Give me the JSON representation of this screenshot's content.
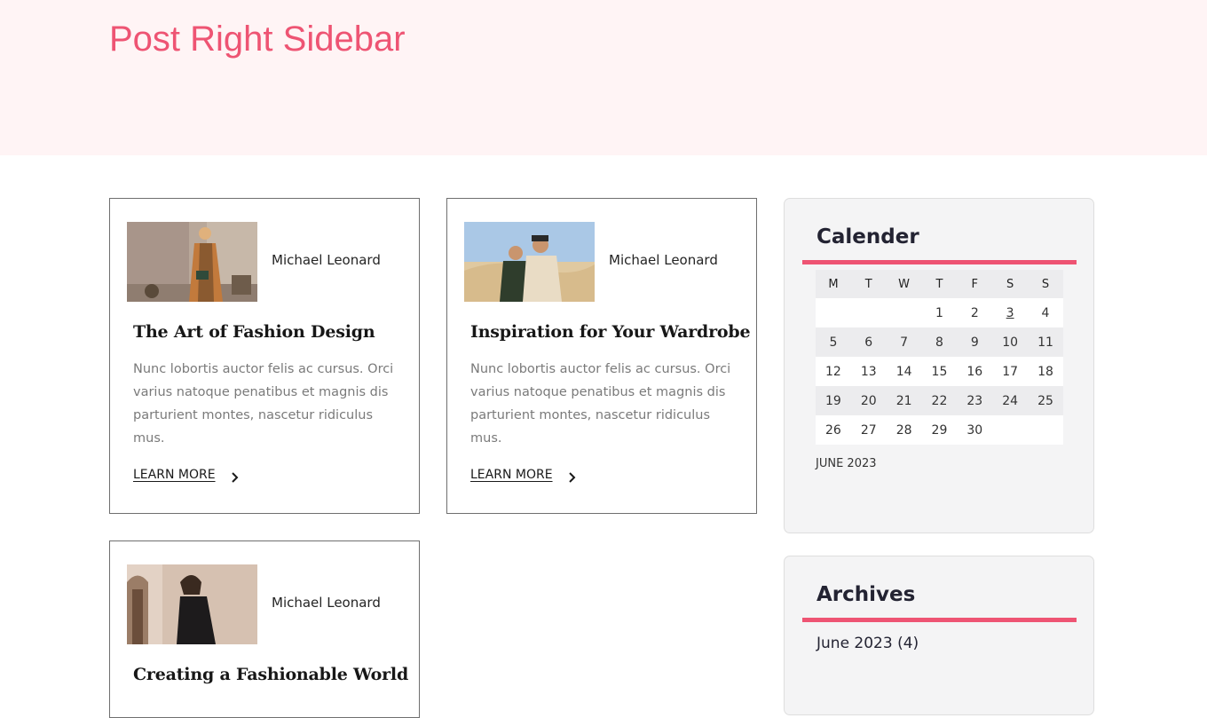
{
  "page": {
    "title": "Post Right Sidebar"
  },
  "posts": [
    {
      "author": "Michael Leonard",
      "title": "The Art of Fashion Design",
      "excerpt": "Nunc lobortis auctor felis ac cursus. Orci varius natoque penatibus et magnis dis parturient montes, nascetur ridiculus mus.",
      "link_label": "LEARN MORE",
      "image": "woman-in-tan-blazer-photo"
    },
    {
      "author": "Michael Leonard",
      "title": "Inspiration for Your Wardrobe",
      "excerpt": "Nunc lobortis auctor felis ac cursus. Orci varius natoque penatibus et magnis dis parturient montes, nascetur ridiculus mus.",
      "link_label": "LEARN MORE",
      "image": "couple-in-desert-photo"
    },
    {
      "author": "Michael Leonard",
      "title": "Creating a Fashionable World",
      "image": "woman-in-doorway-photo"
    }
  ],
  "sidebar": {
    "calendar": {
      "title": "Calender",
      "weekdays": [
        "M",
        "T",
        "W",
        "T",
        "F",
        "S",
        "S"
      ],
      "weeks": [
        [
          "",
          "",
          "",
          "1",
          "2",
          "3",
          "4"
        ],
        [
          "5",
          "6",
          "7",
          "8",
          "9",
          "10",
          "11"
        ],
        [
          "12",
          "13",
          "14",
          "15",
          "16",
          "17",
          "18"
        ],
        [
          "19",
          "20",
          "21",
          "22",
          "23",
          "24",
          "25"
        ],
        [
          "26",
          "27",
          "28",
          "29",
          "30",
          "",
          ""
        ]
      ],
      "linked_day": "3",
      "caption": "JUNE 2023"
    },
    "archives": {
      "title": "Archives",
      "items": [
        "June 2023 (4)"
      ]
    }
  },
  "colors": {
    "accent": "#ee5473",
    "hero_bg": "#fff4f5",
    "widget_bg": "#f4f4f5"
  }
}
